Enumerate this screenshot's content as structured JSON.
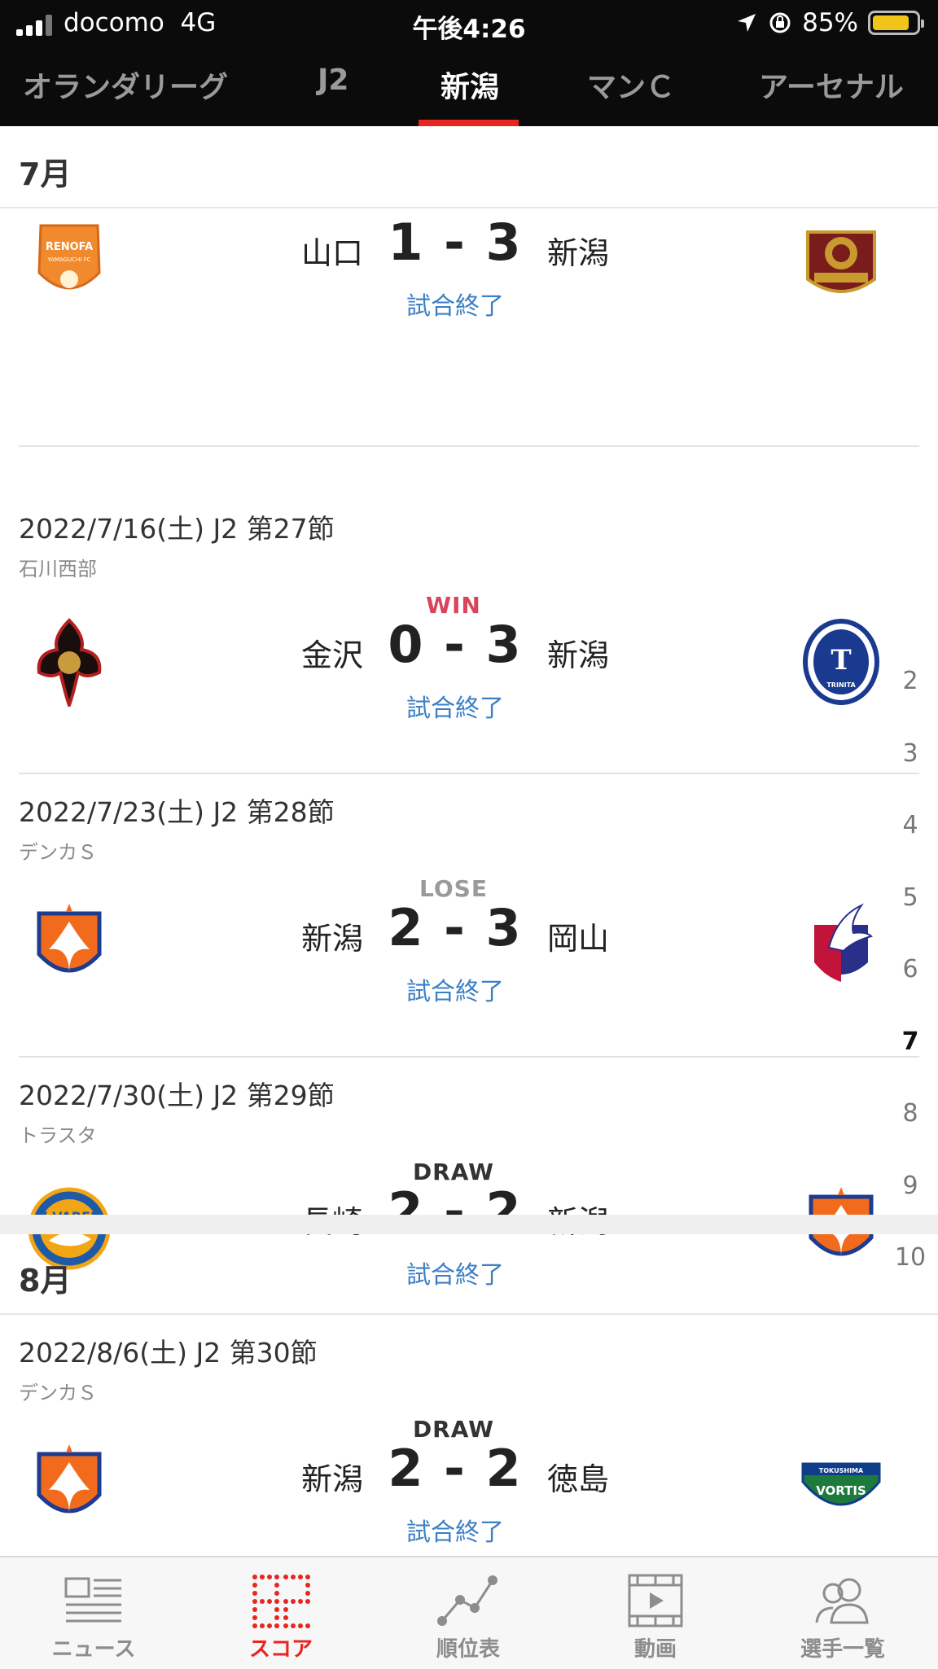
{
  "status_bar": {
    "carrier": "docomo",
    "network": "4G",
    "time": "午後4:26",
    "battery": "85%",
    "battery_level": 0.85
  },
  "tabs": [
    {
      "label": "オランダリーグ",
      "active": false
    },
    {
      "label": "J2",
      "active": false
    },
    {
      "label": "新潟",
      "active": true
    },
    {
      "label": "マンＣ",
      "active": false
    },
    {
      "label": "アーセナル",
      "active": false
    }
  ],
  "sections": [
    {
      "month": "7月",
      "matches": [
        {
          "date": "",
          "venue": "",
          "result": "",
          "home": "山口",
          "away": "新潟",
          "score": "1 - 3",
          "status": "試合終了",
          "home_crest": "renofa-yamaguchi-crest",
          "away_crest": "fagiano-okayama-crest"
        },
        {
          "date": "2022/7/16(土) J2 第27節",
          "venue": "石川西部",
          "result": "WIN",
          "home": "金沢",
          "away": "新潟",
          "score": "0 - 3",
          "status": "試合終了",
          "home_crest": "zweigen-kanazawa-crest",
          "away_crest": "oita-trinita-crest"
        },
        {
          "date": "2022/7/23(土) J2 第28節",
          "venue": "デンカＳ",
          "result": "LOSE",
          "home": "新潟",
          "away": "岡山",
          "score": "2 - 3",
          "status": "試合終了",
          "home_crest": "albirex-niigata-crest",
          "away_crest": "fagiano-okayama-crest"
        },
        {
          "date": "2022/7/30(土) J2 第29節",
          "venue": "トラスタ",
          "result": "DRAW",
          "home": "長崎",
          "away": "新潟",
          "score": "2 - 2",
          "status": "試合終了",
          "home_crest": "v-varen-nagasaki-crest",
          "away_crest": "albirex-niigata-crest"
        }
      ]
    },
    {
      "month": "8月",
      "matches": [
        {
          "date": "2022/8/6(土) J2 第30節",
          "venue": "デンカＳ",
          "result": "DRAW",
          "home": "新潟",
          "away": "徳島",
          "score": "2 - 2",
          "status": "試合終了",
          "home_crest": "albirex-niigata-crest",
          "away_crest": "tokushima-vortis-crest"
        }
      ]
    }
  ],
  "month_index": [
    "2",
    "3",
    "4",
    "5",
    "6",
    "7",
    "8",
    "9",
    "10"
  ],
  "month_index_current": "7",
  "bottom_nav": [
    {
      "label": "ニュース",
      "icon": "news-icon",
      "active": false
    },
    {
      "label": "スコア",
      "icon": "score-icon",
      "active": true
    },
    {
      "label": "順位表",
      "icon": "standings-icon",
      "active": false
    },
    {
      "label": "動画",
      "icon": "video-icon",
      "active": false
    },
    {
      "label": "選手一覧",
      "icon": "players-icon",
      "active": false
    }
  ],
  "colors": {
    "accent": "#e8251f",
    "win": "#d9445a",
    "lose": "#9a9a9a",
    "draw": "#333333",
    "status_link": "#3c7fc4"
  }
}
